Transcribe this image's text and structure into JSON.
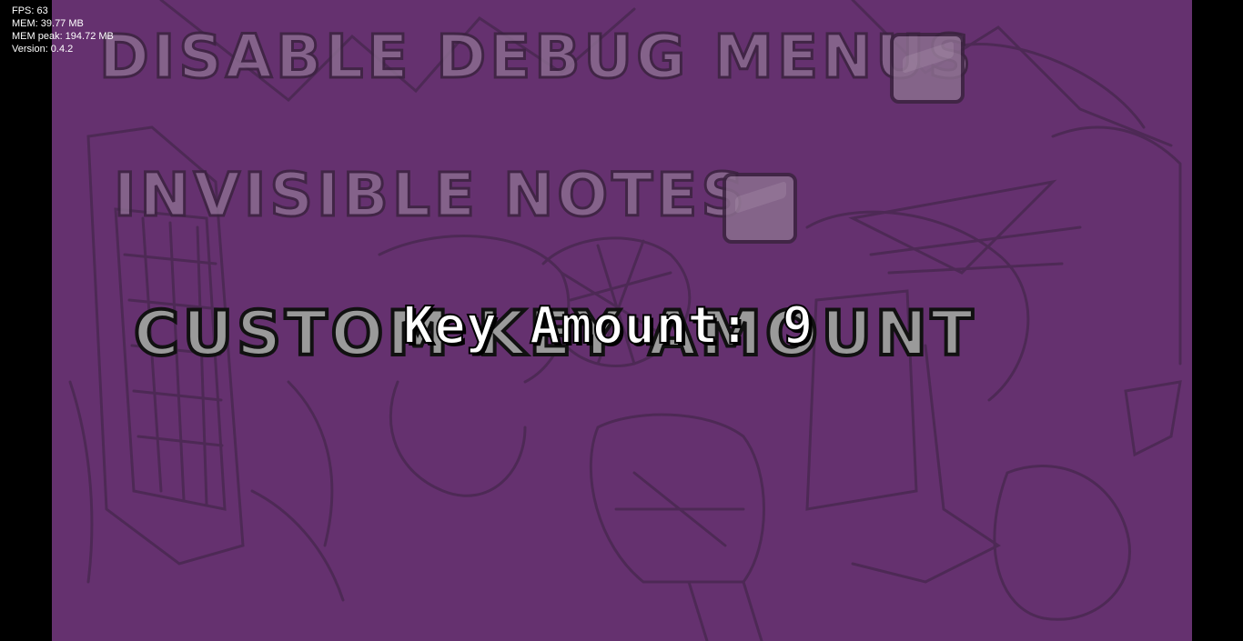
{
  "debug": {
    "fps": "FPS: 63",
    "mem": "MEM: 39.77 MB",
    "mem_peak": "MEM peak: 194.72 MB",
    "version": "Version: 0.4.2"
  },
  "options": [
    {
      "label": "DISABLE DEBUG MENUS",
      "checked": false
    },
    {
      "label": "INVISIBLE NOTES",
      "checked": false
    },
    {
      "label": "CUSTOM KEY AMOUNT"
    }
  ],
  "key_amount": {
    "text": "Key Amount: 9"
  },
  "colors": {
    "background": "#65316f",
    "letterbox": "#000000",
    "sketch_lines": "#3b2340"
  }
}
